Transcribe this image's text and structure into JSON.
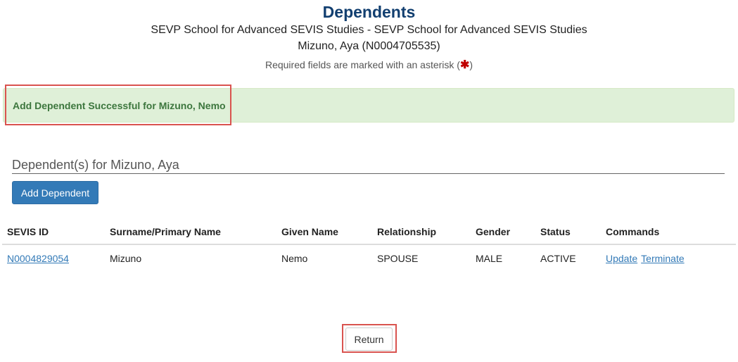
{
  "header": {
    "title": "Dependents",
    "school": "SEVP School for Advanced SEVIS Studies - SEVP School for Advanced SEVIS Studies",
    "person": "Mizuno, Aya (N0004705535)",
    "required_note": "Required fields are marked with an asterisk (",
    "required_asterisk": "✱",
    "required_close": ")"
  },
  "alert": {
    "message": "Add Dependent Successful for Mizuno, Nemo"
  },
  "section": {
    "title": "Dependent(s) for Mizuno, Aya",
    "add_button": "Add Dependent"
  },
  "table": {
    "columns": [
      "SEVIS ID",
      "Surname/Primary Name",
      "Given Name",
      "Relationship",
      "Gender",
      "Status",
      "Commands"
    ],
    "rows": [
      {
        "sevis_id": "N0004829054",
        "surname": "Mizuno",
        "given_name": "Nemo",
        "relationship": "SPOUSE",
        "gender": "MALE",
        "status": "ACTIVE",
        "commands": [
          "Update",
          "Terminate"
        ]
      }
    ]
  },
  "footer": {
    "return_button": "Return"
  },
  "colors": {
    "title": "#123f70",
    "alert_bg": "#dff0d8",
    "alert_text": "#3c763d",
    "primary_button": "#337ab7",
    "highlight": "#d9534f",
    "asterisk": "#c00000"
  }
}
